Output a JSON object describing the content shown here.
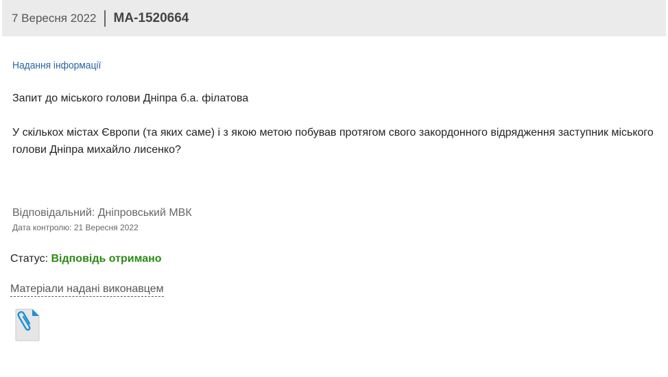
{
  "header": {
    "date": "7 Вересня 2022",
    "request_id": "MA-1520664"
  },
  "request": {
    "category": "Надання інформації",
    "title": "Запит до міського голови Дніпра б.а. філатова",
    "body": "У скількох містах Європи (та яких саме) і з якою метою побував протягом свого закордонного відрядження заступник міського голови Дніпра михайло лисенко?"
  },
  "responsible": {
    "text": "Відповідальний: Дніпровський МВК",
    "control_date": "Дата контролю: 21 Вересня 2022"
  },
  "status": {
    "label": "Статус:",
    "value": "Відповідь отримано",
    "value_color": "#2c8a16"
  },
  "materials": {
    "link_label": "Матеріали надані виконавцем",
    "attachment_icon": "paperclip-file-icon"
  },
  "colors": {
    "accent": "#2b62a3",
    "header_bg": "#ebebeb",
    "file_icon_blue": "#1f8fd6"
  }
}
